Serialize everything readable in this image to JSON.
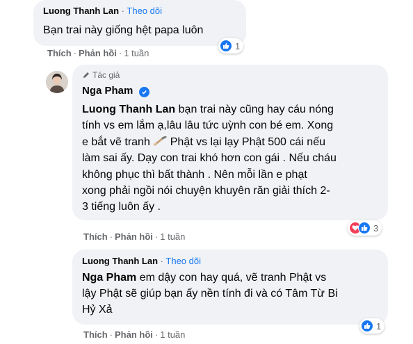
{
  "comments": [
    {
      "author": "Luong Thanh Lan",
      "follow_label": "Theo dõi",
      "text": "Bạn trai này giống hệt papa luôn",
      "actions": {
        "like": "Thích",
        "reply": "Phản hồi",
        "time": "1 tuần"
      },
      "reaction_count": "1"
    },
    {
      "author_badge": "Tác giả",
      "author": "Nga Pham",
      "mention": "Luong Thanh Lan",
      "lines": [
        " bạn trai này cũng hay cáu nóng",
        "tính vs em lắm ạ,lâu lâu tức uỳnh con bé em. Xong",
        "e bắt vẽ tranh",
        " Phật vs lại lạy Phật 500 cái nếu",
        "làm sai ấy. Dạy con trai khó hơn con gái . Nếu cháu",
        "không phục thì bất thành . Nên mỗi lần e phạt",
        "xong phải ngồi nói chuyện khuyên răn giải thích 2-",
        "3 tiếng luôn ấy ."
      ],
      "actions": {
        "like": "Thích",
        "reply": "Phản hồi",
        "time": "1 tuần"
      },
      "reaction_count": "3"
    },
    {
      "author": "Luong Thanh Lan",
      "follow_label": "Theo dõi",
      "mention": "Nga Pham",
      "lines": [
        " em dậy con hay quá, vẽ tranh Phật vs",
        "lậy Phật sẽ giúp bạn ấy nền tính đi và có Tâm Từ Bi",
        "Hỷ Xả"
      ],
      "actions": {
        "like": "Thích",
        "reply": "Phản hồi",
        "time": "1 tuần"
      },
      "reaction_count": "1"
    }
  ],
  "colors": {
    "bubble": "#f0f2f5",
    "link": "#1877f2",
    "meta": "#65676b",
    "love": "#f33e58"
  },
  "icons": [
    "thumbs-up-icon",
    "heart-icon",
    "verified-badge-icon",
    "pencil-icon",
    "paintbrush-emoji-icon"
  ]
}
